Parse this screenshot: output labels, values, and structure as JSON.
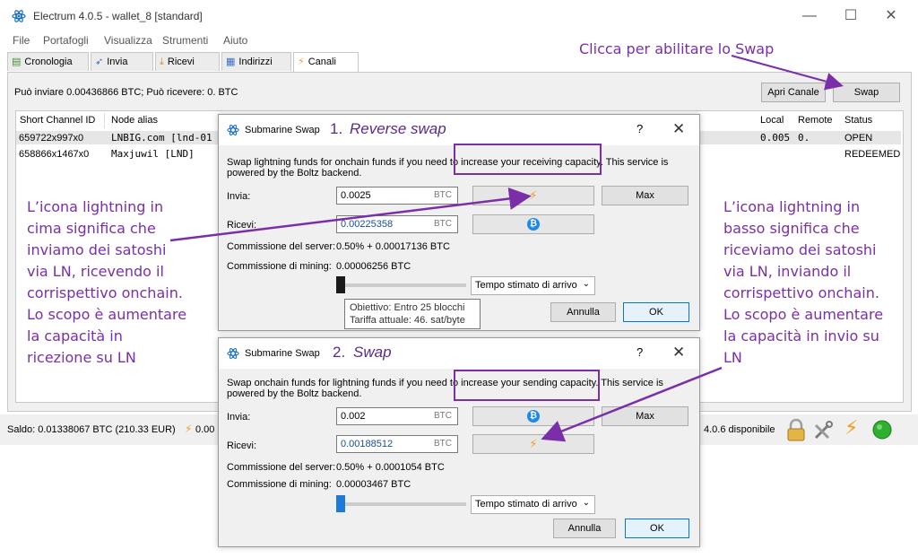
{
  "window": {
    "title": "Electrum 4.0.5  -  wallet_8  [standard]",
    "controls": [
      "—",
      "☐",
      "✕"
    ]
  },
  "menu": [
    "File",
    "Portafogli",
    "Visualizza",
    "Strumenti",
    "Aiuto"
  ],
  "tabs": [
    {
      "label": "Cronologia",
      "icon": "history-icon"
    },
    {
      "label": "Invia",
      "icon": "send-icon"
    },
    {
      "label": "Ricevi",
      "icon": "receive-icon"
    },
    {
      "label": "Indirizzi",
      "icon": "addresses-icon"
    },
    {
      "label": "Canali",
      "icon": "lightning-icon",
      "active": true
    }
  ],
  "channels": {
    "info": "Può inviare 0.00436866 BTC; Può ricevere: 0. BTC",
    "open_channel_label": "Apri Canale",
    "swap_label": "Swap",
    "headers": {
      "scid": "Short Channel ID",
      "alias": "Node alias",
      "local": "Local",
      "remote": "Remote",
      "status": "Status"
    },
    "rows": [
      {
        "scid": "659722x997x0",
        "alias": "LNBIG.com [lnd-01",
        "local": "0.005",
        "remote": "0.",
        "status": "OPEN"
      },
      {
        "scid": "658866x1467x0",
        "alias": "Maxjuwil [LND]",
        "local": "",
        "remote": "",
        "status": "REDEEMED"
      }
    ]
  },
  "statusbar": {
    "balance": "Saldo: 0.01338067 BTC (210.33 EUR)",
    "ln_balance": "0.00",
    "update": "4.0.6 disponibile",
    "icons": [
      "lock-icon",
      "tools-icon",
      "lightning-icon",
      "network-status-icon"
    ]
  },
  "dialog1": {
    "name": "Submarine Swap",
    "step": "1.",
    "step_title": "Reverse swap",
    "help": "?",
    "close": "✕",
    "desc_line1": "Swap lightning funds for onchain funds if you need to increase your receiving capacity. This service is",
    "desc_line2": "powered by the Boltz backend.",
    "send_label": "Invia:",
    "send_value": "0.0025",
    "send_unit": "BTC",
    "max_label": "Max",
    "receive_label": "Ricevi:",
    "receive_value": "0.00225358",
    "receive_unit": "BTC",
    "server_fee_label": "Commissione del server:",
    "server_fee": "0.50%  +  0.00017136 BTC",
    "mining_fee_label": "Commissione di mining:",
    "mining_fee": "0.00006256 BTC",
    "slider_level": 0.0,
    "eta_option": "Tempo stimato di arrivo",
    "tooltip_line1": "Obiettivo: Entro 25 blocchi",
    "tooltip_line2": "Tariffa attuale: 46. sat/byte",
    "cancel_label": "Annulla",
    "ok_label": "OK"
  },
  "dialog2": {
    "name": "Submarine Swap",
    "step": "2.",
    "step_title": "Swap",
    "help": "?",
    "close": "✕",
    "desc_line1": "Swap onchain funds for lightning funds if you need to increase your sending capacity. This service is",
    "desc_line2": "powered by the Boltz backend.",
    "send_label": "Invia:",
    "send_value": "0.002",
    "send_unit": "BTC",
    "max_label": "Max",
    "receive_label": "Ricevi:",
    "receive_value": "0.00188512",
    "receive_unit": "BTC",
    "server_fee_label": "Commissione del server:",
    "server_fee": "0.50%  +  0.0001054 BTC",
    "mining_fee_label": "Commissione di mining:",
    "mining_fee": "0.00003467 BTC",
    "slider_level": 0.0,
    "eta_option": "Tempo stimato di arrivo",
    "cancel_label": "Annulla",
    "ok_label": "OK"
  },
  "annotations": {
    "swap_hint": "Clicca per abilitare lo Swap",
    "left": [
      "L’icona lightning in",
      "cima significa che",
      "inviamo dei satoshi",
      "via LN, ricevendo il",
      "corrispettivo onchain.",
      "Lo scopo è aumentare",
      "la capacità in",
      "ricezione su LN"
    ],
    "right": [
      "L’icona lightning in",
      "basso significa che",
      "riceviamo dei satoshi",
      "via LN, inviando il",
      "corrispettivo onchain.",
      "Lo scopo è aumentare",
      "la capacità in invio su",
      "LN"
    ]
  },
  "colors": {
    "annotation": "#7a2fa8",
    "bolt": "#f59c1a",
    "bitcoin_blue": "#1e88e5",
    "ok_border": "#0078d7"
  }
}
